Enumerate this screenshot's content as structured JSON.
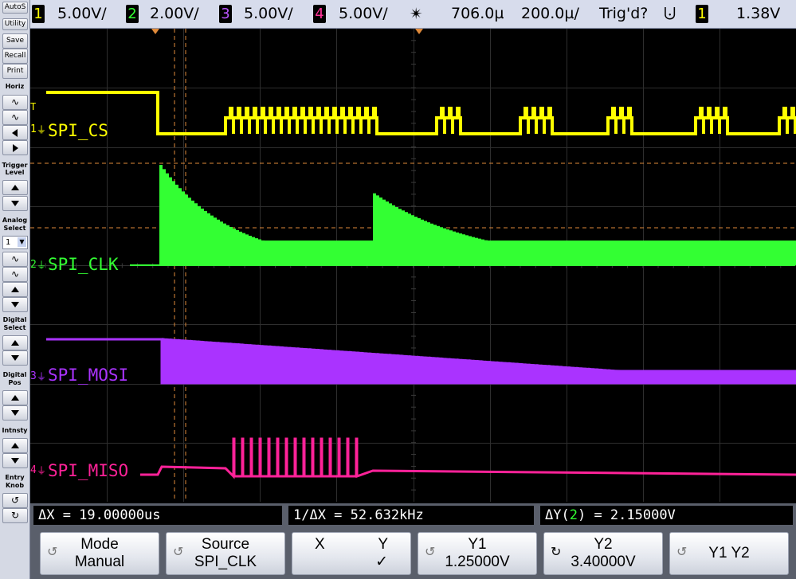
{
  "topbar": {
    "ch1": {
      "num": "1",
      "scale": "5.00V/"
    },
    "ch2": {
      "num": "2",
      "scale": "2.00V/"
    },
    "ch3": {
      "num": "3",
      "scale": "5.00V/"
    },
    "ch4": {
      "num": "4",
      "scale": "5.00V/"
    },
    "horiz_position": "706.0µ",
    "horiz_scale": "200.0µ/",
    "trigger_status": "Trig'd?",
    "trigger_slope_symbol": "⨃",
    "trigger_source": "1",
    "trigger_level": "1.38V"
  },
  "side": {
    "autoscale": "AutoS",
    "utility": "Utility",
    "save": "Save",
    "recall": "Recall",
    "print": "Print",
    "horiz": "Horiz",
    "trigger_level_1": "Trigger",
    "trigger_level_2": "Level",
    "analog_select_1": "Analog",
    "analog_select_2": "Select",
    "analog_select_value": "1",
    "digital_select_1": "Digital",
    "digital_select_2": "Select",
    "digital_pos_1": "Digital",
    "digital_pos_2": "Pos",
    "intensity": "Intnsty",
    "entry_knob_1": "Entry",
    "entry_knob_2": "Knob"
  },
  "channels": [
    {
      "num": "1",
      "label": "SPI_CS",
      "color": "#ffff00"
    },
    {
      "num": "2",
      "label": "SPI_CLK",
      "color": "#33ff33"
    },
    {
      "num": "3",
      "label": "SPI_MOSI",
      "color": "#aa33ff"
    },
    {
      "num": "4",
      "label": "SPI_MISO",
      "color": "#ff2299"
    }
  ],
  "measurements": {
    "delta_x": "ΔX = 19.00000us",
    "inv_delta_x": "1/ΔX = 52.632kHz",
    "delta_y_prefix": "ΔY(",
    "delta_y_ch": "2",
    "delta_y_suffix": ") = 2.15000V"
  },
  "softkeys": [
    {
      "l1": "Mode",
      "l2": "Manual"
    },
    {
      "l1": "Source",
      "l2": "SPI_CLK"
    },
    {
      "l1": "X",
      "l1b": "Y",
      "l2": "✓"
    },
    {
      "l1": "Y1",
      "l2": "1.25000V"
    },
    {
      "l1": "Y2",
      "l2": "3.40000V"
    },
    {
      "l1": "Y1 Y2",
      "l2": ""
    }
  ]
}
